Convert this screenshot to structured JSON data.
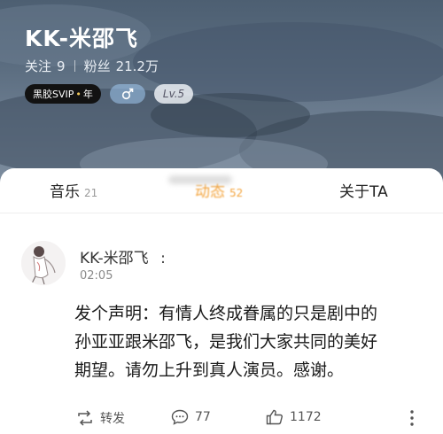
{
  "profile": {
    "name": "KK-米邵飞",
    "following_label": "关注",
    "following_count": "9",
    "followers_label": "粉丝",
    "followers_count": "21.2万",
    "vip_badge_text": "黑胶SVIP",
    "vip_badge_suffix": "年",
    "gender_icon": "male-icon",
    "level_text": "Lv.5"
  },
  "tabs": [
    {
      "label": "音乐",
      "count": "21"
    },
    {
      "label": "动态",
      "count": "52",
      "active": true
    },
    {
      "label": "关于TA",
      "count": ""
    }
  ],
  "post": {
    "author": "KK-米邵飞",
    "author_suffix": ":",
    "time": "02:05",
    "text_lines": [
      "发个声明：有情人终成眷属的只是剧中的",
      "孙亚亚跟米邵飞，是我们大家共同的美好",
      "期望。请勿上升到真人演员。感谢。"
    ],
    "actions": {
      "repost_label": "转发",
      "comment_count": "77",
      "like_count": "1172"
    }
  },
  "colors": {
    "accent": "#f3a33b",
    "header_sky": "#5b6d80",
    "badge_dark": "#121212"
  }
}
